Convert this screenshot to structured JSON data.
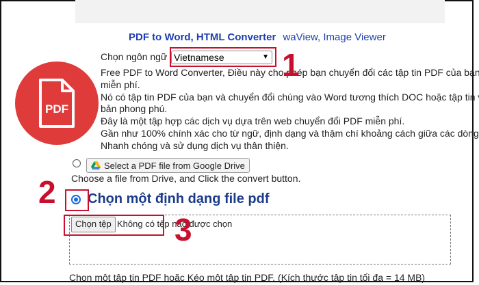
{
  "nav": {
    "brand": "PDF to Word, HTML Converter",
    "links": "waView, Image Viewer"
  },
  "logo": {
    "text": "PDF",
    "color": "#e03b3b"
  },
  "language": {
    "label": "Chọn ngôn ngữ",
    "selected": "Vietnamese"
  },
  "description": [
    "Free PDF to Word Converter, Điều này cho phép bạn chuyển đổi các tập tin PDF của bạn c",
    "miễn phí.",
    "Nó có tập tin PDF của bạn và chuyển đổi chúng vào Word tương thích DOC hoặc tập tin v",
    "bản phong phú.",
    "Đây là một tập hợp các dịch vụ dựa trên web chuyển đổi PDF miễn phí.",
    "Gần như 100% chính xác cho từ ngữ, định dạng và thậm chí khoảng cách giữa các dòng.",
    "Nhanh chóng và sử dụng dịch vụ thân thiện."
  ],
  "drive": {
    "button_label": "Select a PDF file from Google Drive",
    "hint": "Choose a file from Drive, and Click the convert button."
  },
  "upload": {
    "heading": "Chọn một định dạng file pdf",
    "choose_button": "Chọn tệp",
    "status": "Không có tệp nào được chọn",
    "note": "Chọn một tập tin PDF hoặc Kéo một tập tin PDF. (Kích thước tập tin tối đa = 14 MB)"
  },
  "annotations": {
    "one": "1",
    "two": "2",
    "three": "3",
    "color": "#c8102e"
  }
}
